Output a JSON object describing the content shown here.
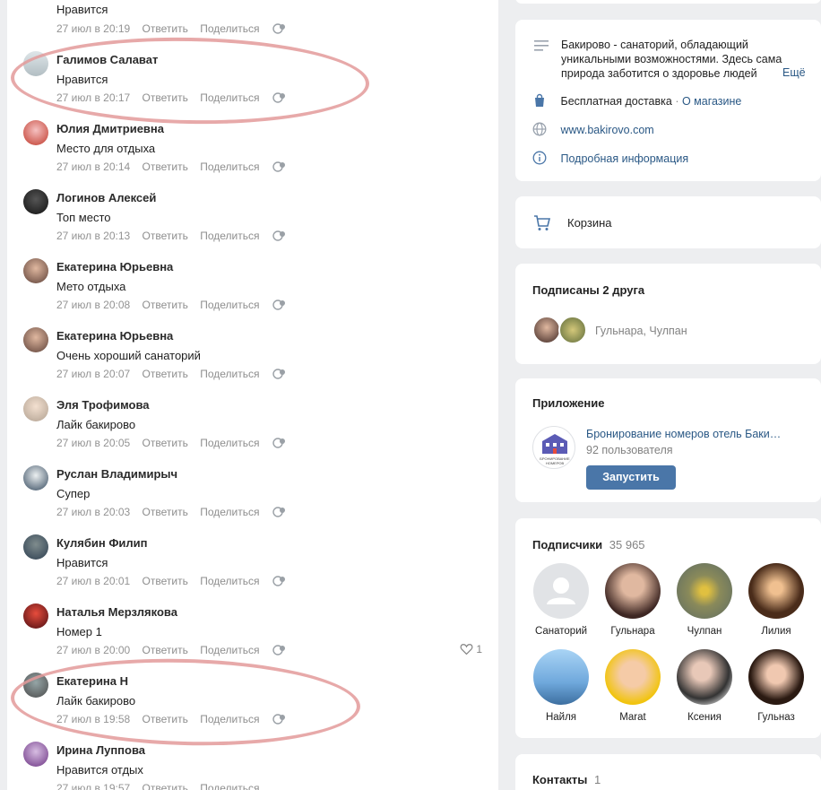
{
  "comments": [
    {
      "name": "",
      "text": "Нравится",
      "time": "27 июл в 20:19"
    },
    {
      "name": "Галимов Салават",
      "text": "Нравится",
      "time": "27 июл в 20:17"
    },
    {
      "name": "Юлия Дмитриевна",
      "text": "Место для отдыха",
      "time": "27 июл в 20:14"
    },
    {
      "name": "Логинов Алексей",
      "text": "Топ место",
      "time": "27 июл в 20:13"
    },
    {
      "name": "Екатерина Юрьевна",
      "text": "Мето отдыха",
      "time": "27 июл в 20:08"
    },
    {
      "name": "Екатерина Юрьевна",
      "text": "Очень хороший санаторий",
      "time": "27 июл в 20:07"
    },
    {
      "name": "Эля Трофимова",
      "text": "Лайк бакирово",
      "time": "27 июл в 20:05"
    },
    {
      "name": "Руслан Владимирыч",
      "text": "Супер",
      "time": "27 июл в 20:03"
    },
    {
      "name": "Кулябин Филип",
      "text": "Нравится",
      "time": "27 июл в 20:01"
    },
    {
      "name": "Наталья Мерзлякова",
      "text": "Номер 1",
      "time": "27 июл в 20:00",
      "likes": "1"
    },
    {
      "name": "Екатерина Н",
      "text": "Лайк бакирово",
      "time": "27 июл в 19:58"
    },
    {
      "name": "Ирина Луппова",
      "text": "Нравится отдых",
      "time": "27 июл в 19:57"
    }
  ],
  "actions": {
    "reply": "Ответить",
    "share": "Поделиться"
  },
  "info": {
    "description": "Бакирово - санаторий, обладающий уникальными возможностями. Здесь сама природа заботится о здоровье людей",
    "more": "Ещё",
    "delivery": "Бесплатная доставка",
    "about_shop": "О магазине",
    "website": "www.bakirovo.com",
    "details": "Подробная информация"
  },
  "cart": {
    "label": "Корзина"
  },
  "friends": {
    "title": "Подписаны 2 друга",
    "names": "Гульнара, Чулпан"
  },
  "app": {
    "title": "Приложение",
    "name": "Бронирование номеров отель Баки…",
    "users": "92 пользователя",
    "button": "Запустить",
    "logo_text": "БРОНИРОВАНИЕ НОМЕРОВ"
  },
  "subscribers": {
    "title": "Подписчики",
    "count": "35 965",
    "items": [
      {
        "name": "Санаторий"
      },
      {
        "name": "Гульнара"
      },
      {
        "name": "Чулпан"
      },
      {
        "name": "Лилия"
      },
      {
        "name": "Найля"
      },
      {
        "name": "Marat"
      },
      {
        "name": "Ксения"
      },
      {
        "name": "Гульназ"
      }
    ]
  },
  "contacts": {
    "title": "Контакты",
    "count": "1"
  },
  "colors": {
    "link": "#2a5885",
    "button": "#4a76a8",
    "marker": "#e39a9a"
  }
}
